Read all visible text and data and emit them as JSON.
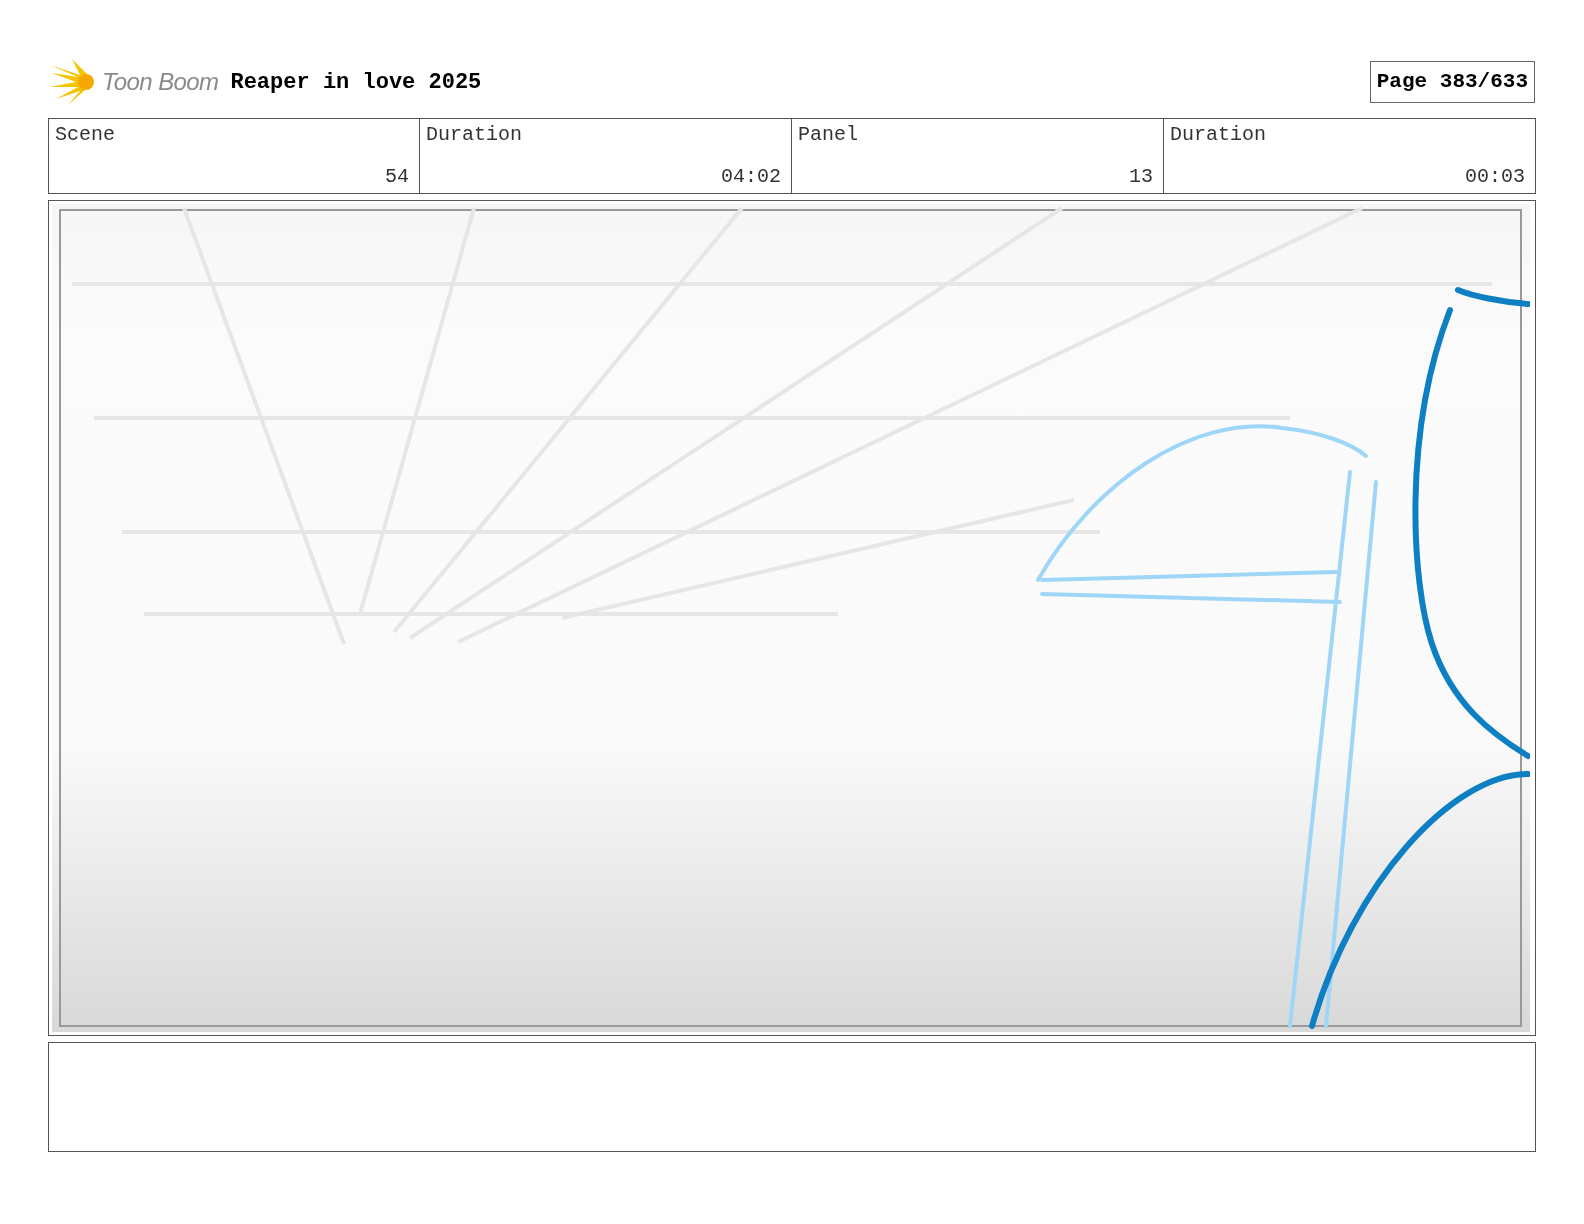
{
  "header": {
    "logo_text": "Toon Boom",
    "title": "Reaper in love 2025",
    "page": "Page 383/633"
  },
  "info": {
    "labels": [
      "Scene",
      "Duration",
      "Panel",
      "Duration"
    ],
    "values": [
      "54",
      "04:02",
      "13",
      "00:03"
    ]
  }
}
